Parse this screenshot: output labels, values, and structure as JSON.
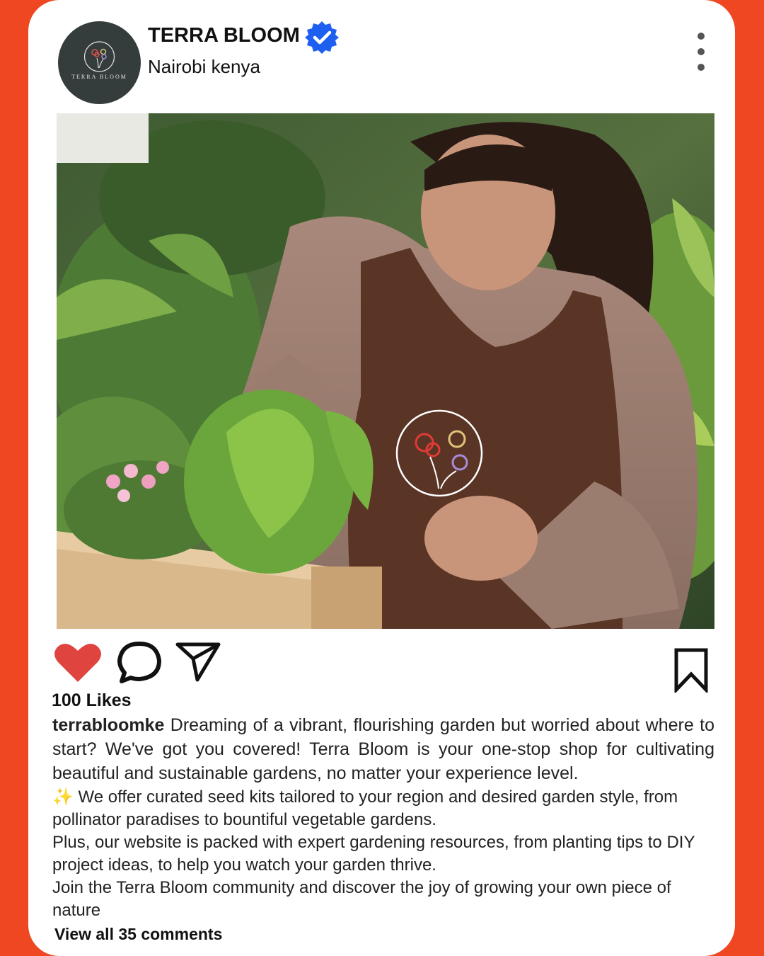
{
  "post": {
    "account_name": "TERRA BLOOM",
    "verified": true,
    "location": "Nairobi kenya",
    "avatar_text": "TERRA BLOOM",
    "likes": "100 Likes",
    "caption_user": "terrabloomke",
    "caption_lead": "Dreaming of a vibrant, flourishing garden but worried about where to start? We've got you covered! Terra Bloom is your one-stop shop for cultivating beautiful and sustainable gardens, no matter your experience level.",
    "caption_line_2": "✨ We offer curated seed kits tailored to your region and desired garden style, from pollinator paradises to bountiful vegetable gardens.",
    "caption_line_3": "Plus, our website is packed with expert gardening resources, from planting tips to DIY project ideas, to help you watch your garden thrive.",
    "caption_line_4": "Join the Terra Bloom community and discover the joy of growing your own piece of nature",
    "view_comments": "View all 35 comments"
  },
  "icons": {
    "like": "heart-icon",
    "comment": "comment-icon",
    "share": "send-icon",
    "save": "bookmark-icon",
    "more": "more-vertical-icon",
    "verified": "verified-badge-icon"
  },
  "colors": {
    "background": "#ee4722",
    "card": "#ffffff",
    "like": "#e0443f",
    "verified": "#1d5ff0",
    "avatar": "#343c3c"
  }
}
